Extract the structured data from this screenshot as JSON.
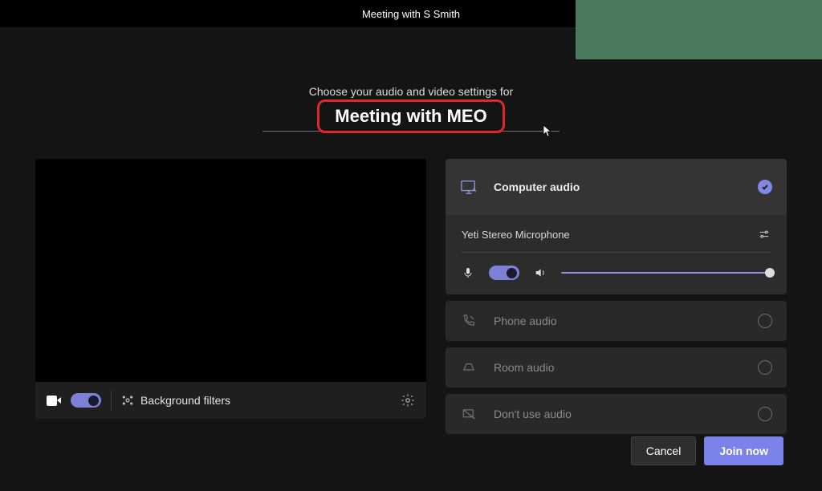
{
  "titlebar": {
    "title": "Meeting with S Smith"
  },
  "prompt": {
    "line1": "Choose your audio and video settings for",
    "meeting_name": "Meeting with MEO"
  },
  "video_controls": {
    "camera_on": true,
    "bg_filters_label": "Background filters"
  },
  "audio_panel": {
    "computer_audio": {
      "label": "Computer audio",
      "selected": true,
      "device": "Yeti Stereo Microphone",
      "mic_on": true,
      "volume": 100
    },
    "phone_audio": {
      "label": "Phone audio"
    },
    "room_audio": {
      "label": "Room audio"
    },
    "no_audio": {
      "label": "Don't use audio"
    }
  },
  "footer": {
    "cancel": "Cancel",
    "join": "Join now"
  },
  "colors": {
    "accent": "#7b83eb",
    "highlight": "#e02828"
  }
}
